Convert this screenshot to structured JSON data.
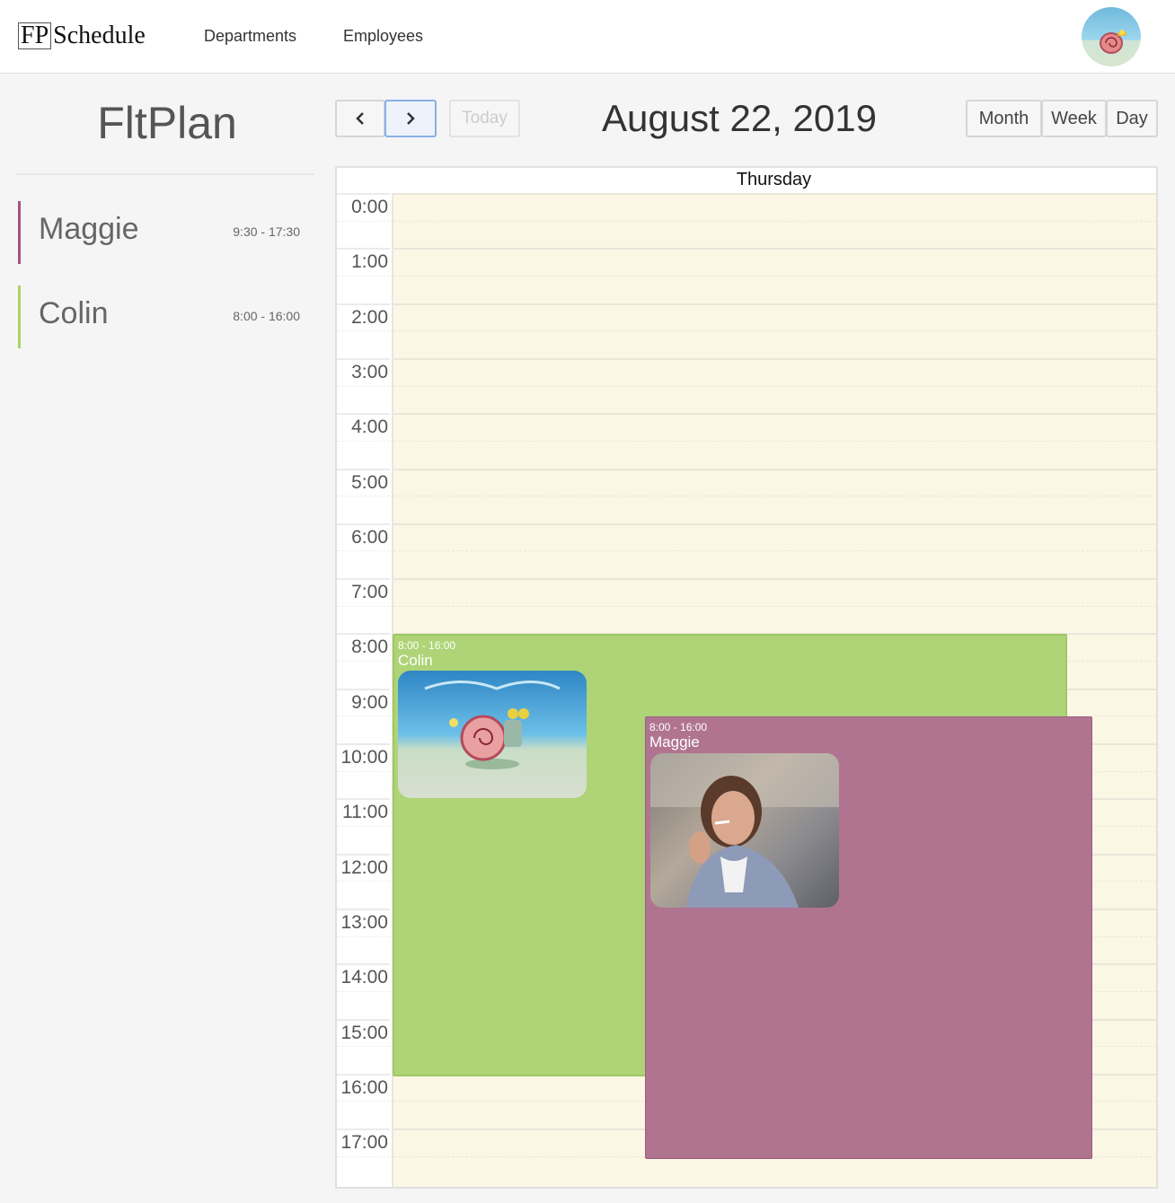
{
  "nav": {
    "logo_fp": "FP",
    "logo_schedule": "Schedule",
    "links": [
      "Departments",
      "Employees"
    ]
  },
  "sidebar": {
    "title": "FltPlan",
    "employees": [
      {
        "name": "Maggie",
        "hours": "9:30 - 17:30",
        "color": "#a4537d"
      },
      {
        "name": "Colin",
        "hours": "8:00 - 16:00",
        "color": "#a8d36a"
      }
    ]
  },
  "toolbar": {
    "prev_icon": "chevron-left-icon",
    "next_icon": "chevron-right-icon",
    "today_label": "Today",
    "date_title": "August 22, 2019",
    "views": [
      "Month",
      "Week",
      "Day"
    ]
  },
  "calendar": {
    "day_header": "Thursday",
    "hours": [
      "0:00",
      "1:00",
      "2:00",
      "3:00",
      "4:00",
      "5:00",
      "6:00",
      "7:00",
      "8:00",
      "9:00",
      "10:00",
      "11:00",
      "12:00",
      "13:00",
      "14:00",
      "15:00",
      "16:00",
      "17:00"
    ],
    "events": [
      {
        "time": "8:00 - 16:00",
        "name": "Colin",
        "color": "#aed477"
      },
      {
        "time": "8:00 - 16:00",
        "name": "Maggie",
        "color": "#b07491"
      }
    ]
  }
}
